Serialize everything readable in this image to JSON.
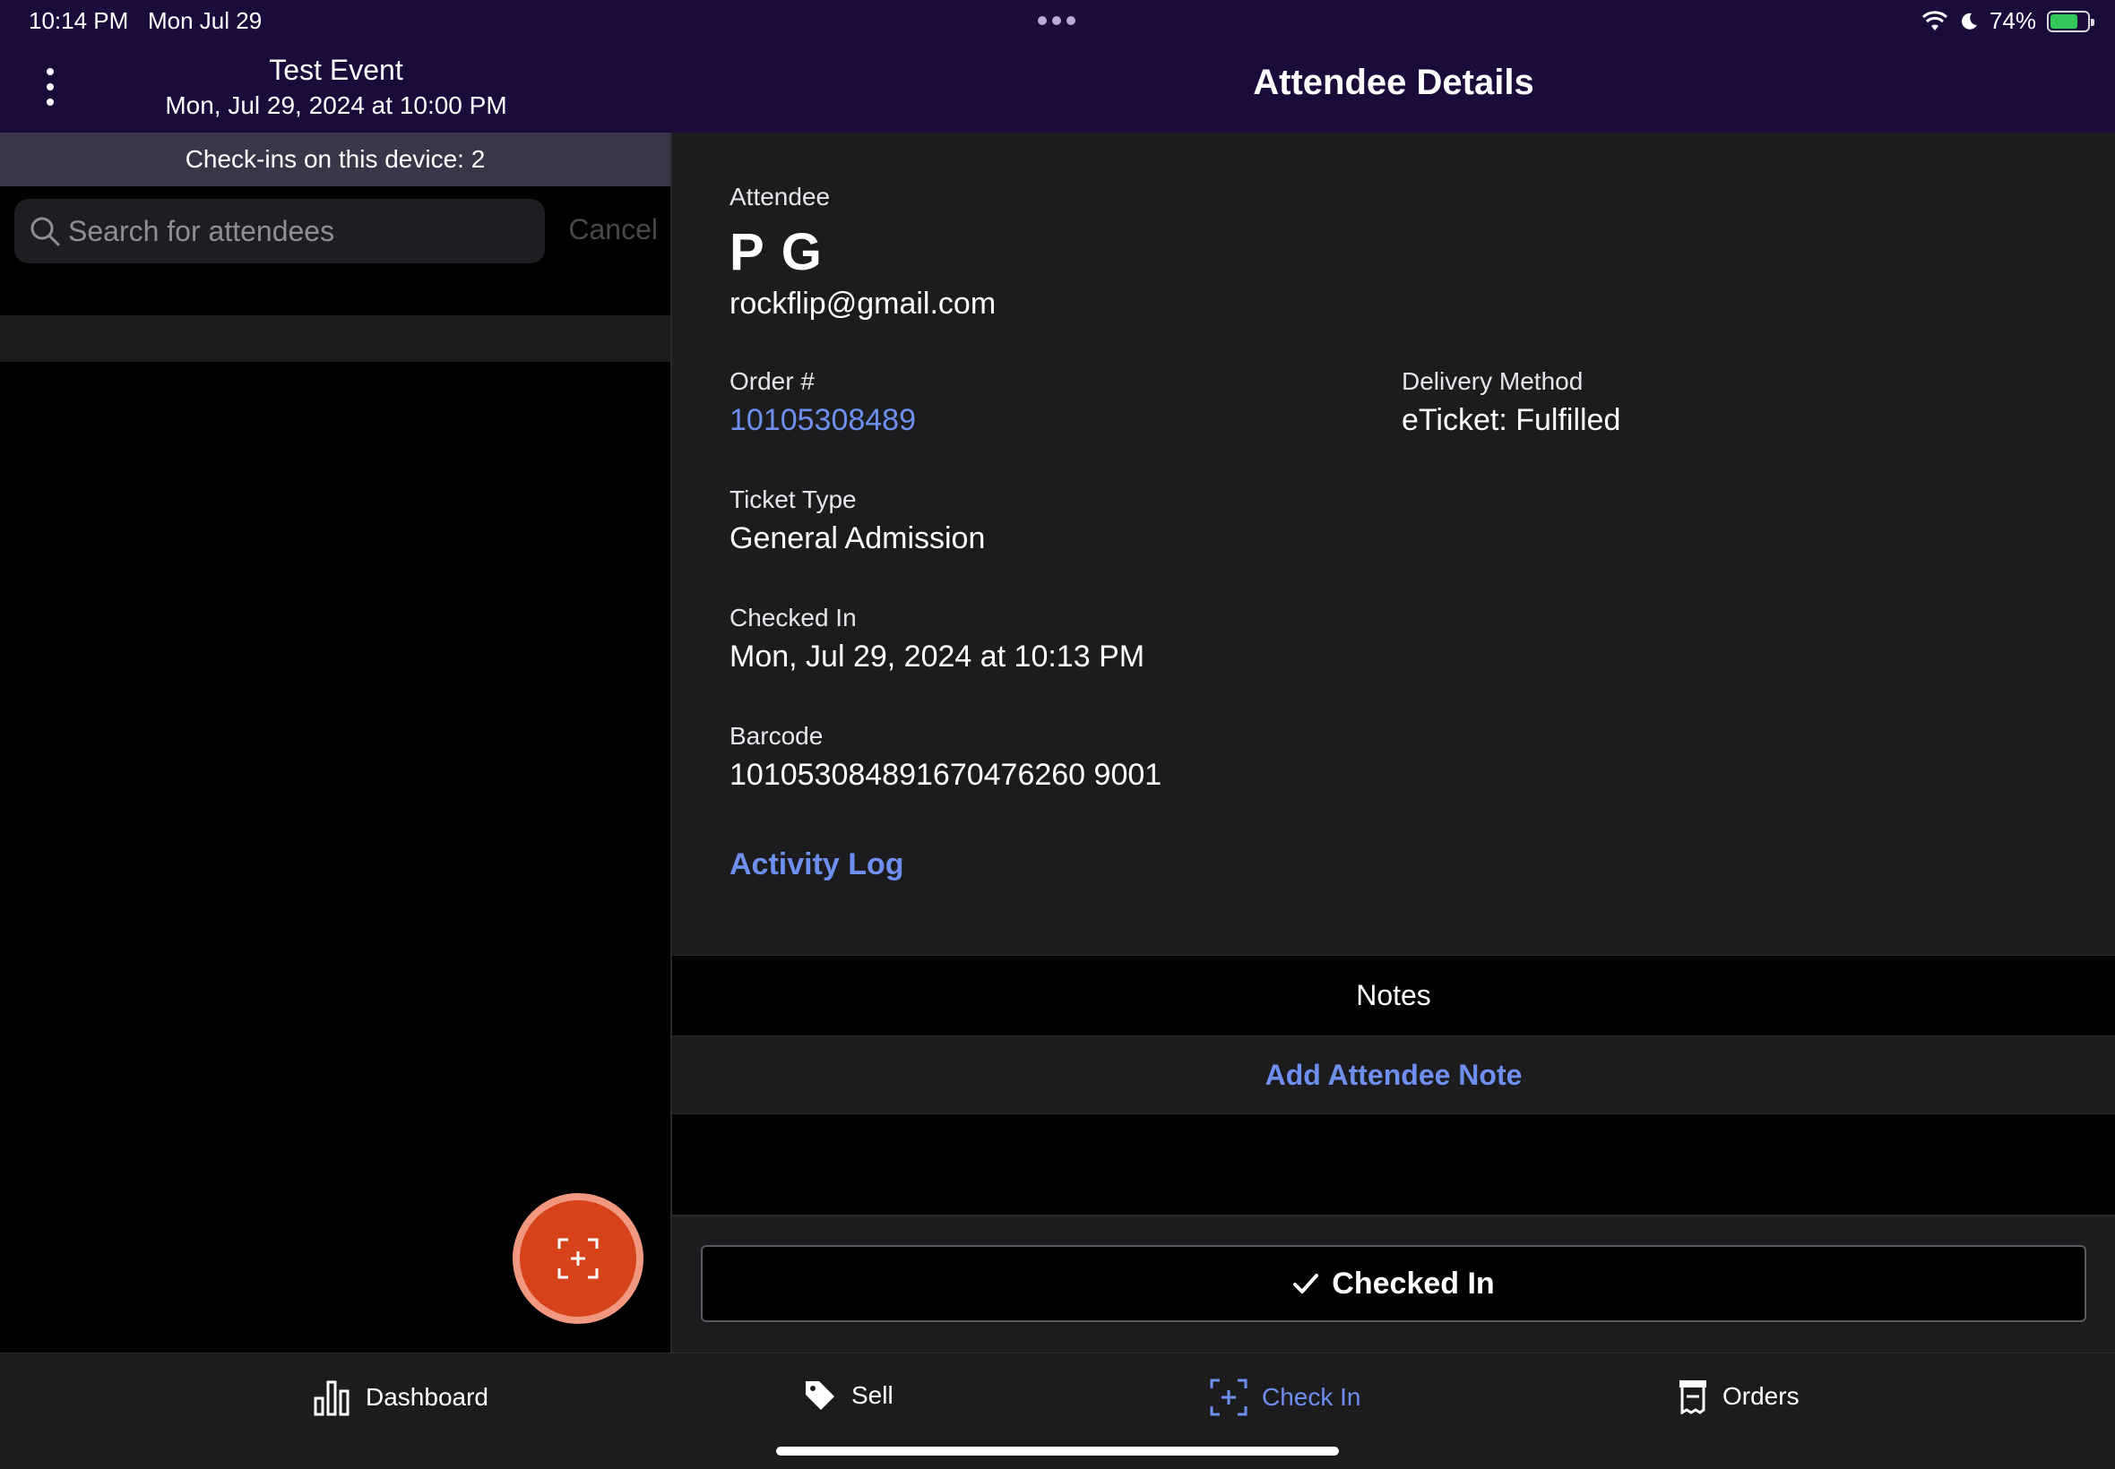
{
  "status_bar": {
    "time": "10:14 PM",
    "date": "Mon Jul 29",
    "battery": "74%",
    "battery_level": 0.74,
    "icons": [
      "wifi-icon",
      "moon-icon",
      "battery-charging-icon"
    ]
  },
  "event": {
    "title": "Test Event",
    "date": "Mon, Jul 29, 2024 at 10:00 PM",
    "checkins": "Check-ins on this device: 2"
  },
  "search": {
    "placeholder": "Search for attendees",
    "cancel_label": "Cancel"
  },
  "detail": {
    "title": "Attendee Details",
    "attendee_label": "Attendee",
    "attendee_name": "P G",
    "attendee_email": "rockflip@gmail.com",
    "order_label": "Order #",
    "order_number": "10105308489",
    "delivery_label": "Delivery Method",
    "delivery_value": "eTicket: Fulfilled",
    "ticket_type_label": "Ticket Type",
    "ticket_type_value": "General Admission",
    "checked_in_label": "Checked In",
    "checked_in_value": "Mon, Jul 29, 2024 at 10:13 PM",
    "barcode_label": "Barcode",
    "barcode_value": "101053084891670476260 9001",
    "activity_log": "Activity Log"
  },
  "notes": {
    "header": "Notes",
    "add_label": "Add Attendee Note"
  },
  "checked_in_button": "Checked In",
  "tabs": [
    {
      "label": "Dashboard",
      "icon": "bar-chart-icon",
      "active": false
    },
    {
      "label": "Sell",
      "icon": "tag-icon",
      "active": false
    },
    {
      "label": "Check In",
      "icon": "scan-icon",
      "active": true
    },
    {
      "label": "Orders",
      "icon": "receipt-icon",
      "active": false
    }
  ],
  "colors": {
    "header_bg": "#1b0b3a",
    "link": "#6f8ff0",
    "fab": "#d6421a",
    "battery": "#34c759"
  }
}
